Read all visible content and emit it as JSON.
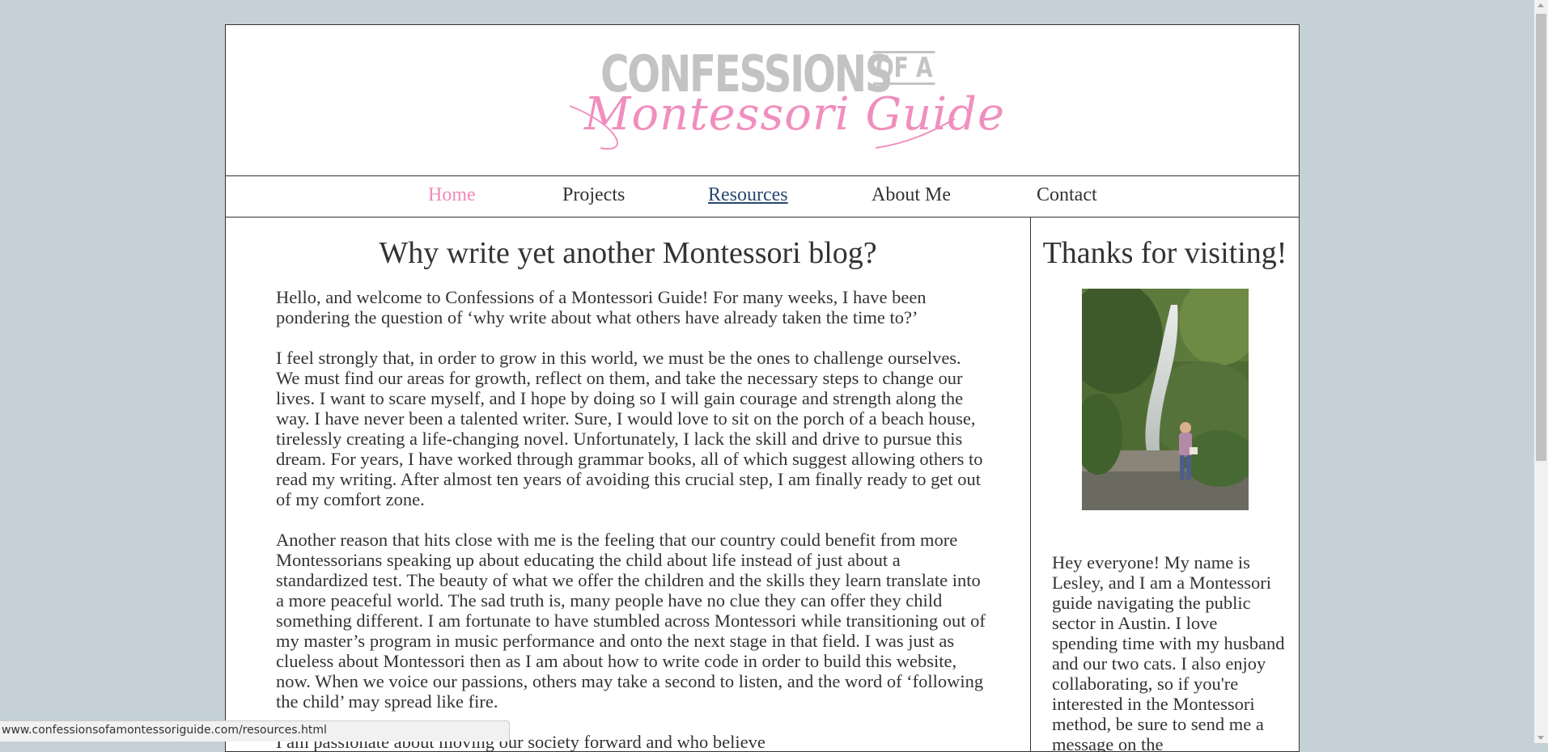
{
  "header": {
    "logo_top": "CONFESSIONS",
    "logo_ofa": "OF A",
    "logo_script": "Montessori Guide"
  },
  "nav": {
    "items": [
      {
        "label": "Home",
        "state": "active"
      },
      {
        "label": "Projects",
        "state": "normal"
      },
      {
        "label": "Resources",
        "state": "hover"
      },
      {
        "label": "About Me",
        "state": "normal"
      },
      {
        "label": "Contact",
        "state": "normal"
      }
    ]
  },
  "main": {
    "title": "Why write yet another Montessori blog?",
    "paragraphs": [
      "Hello, and welcome to Confessions of a Montessori Guide! For many weeks, I have been pondering the question of ‘why write about what others have already taken the time to?’",
      "I feel strongly that, in order to grow in this world, we must be the ones to challenge ourselves. We must find our areas for growth, reflect on them, and take the necessary steps to change our lives. I want to scare myself, and I hope by doing so I will gain courage and strength along the way. I have never been a talented writer. Sure, I would love to sit on the porch of a beach house, tirelessly creating a life-changing novel. Unfortunately, I lack the skill and drive to pursue this dream. For years, I have worked through grammar books, all of which suggest allowing others to read my writing. After almost ten years of avoiding this crucial step, I am finally ready to get out of my comfort zone.",
      "Another reason that hits close with me is the feeling that our country could benefit from more Montessorians speaking up about educating the child about life instead of just about a standardized test. The beauty of what we offer the children and the skills they learn translate into a more peaceful world. The sad truth is, many people have no clue they can offer they child something different. I am fortunate to have stumbled across Montessori while transitioning out of my master’s program in music performance and onto the next stage in that field. I was just as clueless about Montessori then as I am about how to write code in order to build this website, now. When we voice our passions, others may take a second to listen, and the word of ‘following the child’ may spread like fire.",
      "I am passionate about moving our society forward and who believe"
    ]
  },
  "sidebar": {
    "title": "Thanks for visiting!",
    "bio": "Hey everyone! My name is Lesley, and I am a Montessori guide navigating the public sector in Austin. I love spending time with my husband and our two cats. I also enjoy collaborating, so if you're interested in the Montessori method, be sure to send me a message on the"
  },
  "status_bar": {
    "url": "www.confessionsofamontessoriguide.com/resources.html"
  },
  "colors": {
    "page_background": "#c5d1d7",
    "brand_pink": "#ef8ab9",
    "logo_gray": "#c3c3c3",
    "link_hover": "#29476f"
  }
}
